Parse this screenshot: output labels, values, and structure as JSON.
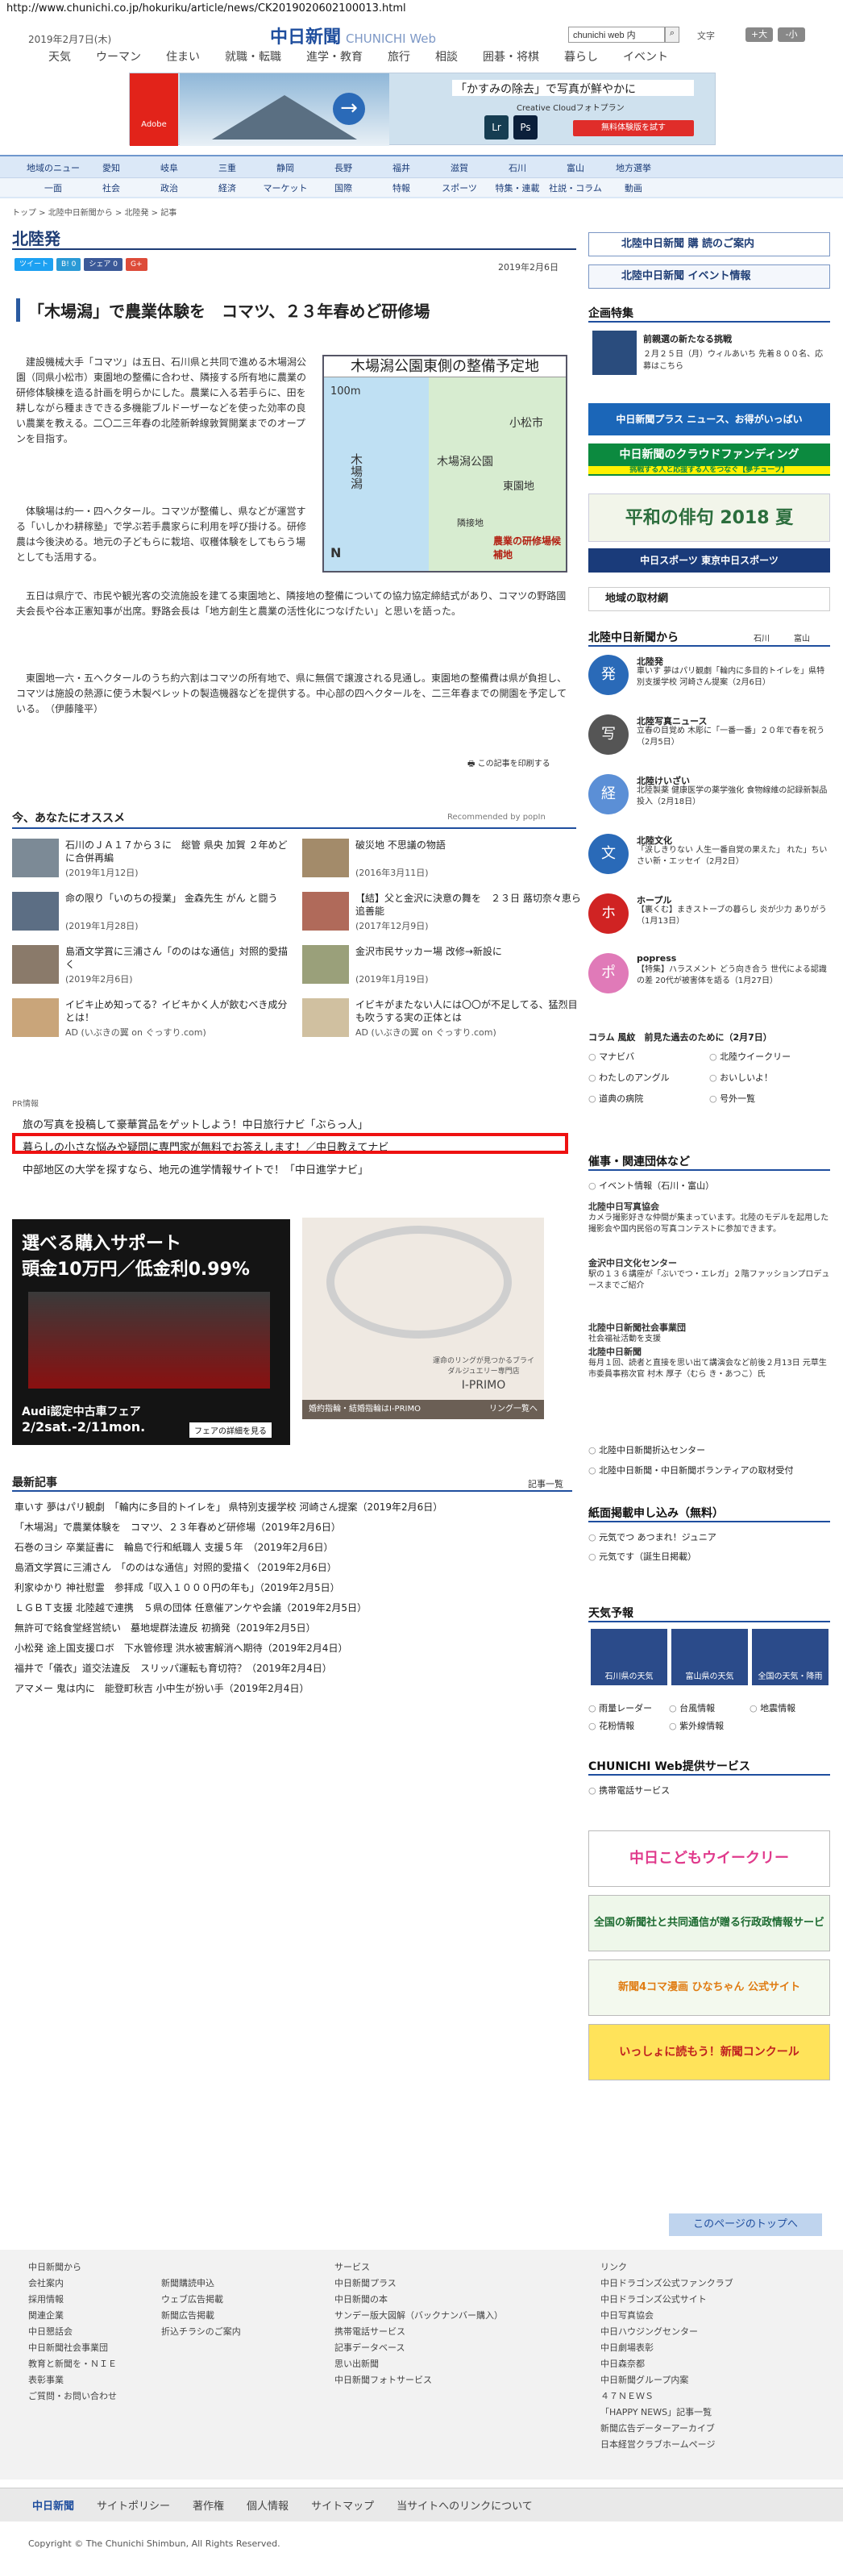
{
  "url": "http://www.chunichi.co.jp/hokuriku/article/news/CK2019020602100013.html",
  "date": "2019年2月7日(木)",
  "logo": {
    "jp": "中日新聞",
    "en": "CHUNICHI Web"
  },
  "search": {
    "value": "chunichi web 内"
  },
  "fontsize": {
    "label": "文字",
    "large": "+大",
    "small": "-小"
  },
  "topnav": [
    "天気",
    "ウーマン",
    "住まい",
    "就職・転職",
    "進学・教育",
    "旅行",
    "相談",
    "囲碁・将棋",
    "暮らし",
    "イベント"
  ],
  "ad_top": {
    "text": "「かすみの除去」で写真が鮮やかに",
    "sub": "Creative Cloudフォトプラン",
    "cta": "無料体験版を試す",
    "lr": "Lr",
    "ps": "Ps",
    "adobe": "Adobe"
  },
  "navrow1": [
    "地域のニュース",
    "愛知",
    "岐阜",
    "三重",
    "静岡",
    "長野",
    "福井",
    "滋賀",
    "石川",
    "富山",
    "地方選挙"
  ],
  "navrow2": [
    "一面",
    "社会",
    "政治",
    "経済",
    "マーケット",
    "国際",
    "特報",
    "スポーツ",
    "特集・連載",
    "社説・コラム",
    "動画"
  ],
  "breadcrumb": "トップ > 北陸中日新聞から > 北陸発 > 記事",
  "section_title": "北陸発",
  "share": {
    "tweet": "ツイート",
    "b": "B! 0",
    "share": "シェア 0",
    "g": "G+"
  },
  "pubdate": "2019年2月6日",
  "headline": "「木場潟」で農業体験を　コマツ、２３年春めど研修場",
  "paragraphs": [
    "　建設機械大手「コマツ」は五日、石川県と共同で進める木場潟公園（同県小松市）東園地の整備に合わせ、隣接する所有地に農業の研修体験棟を造る計画を明らかにした。農業に入る若手らに、田を耕しながら種まきできる多機能ブルドーザーなどを使った効率の良い農業を教える。二〇二三年春の北陸新幹線敦賀開業までのオープンを目指す。",
    "　体験場は約一・四ヘクタール。コマツが整備し、県などが運営する「いしかわ耕稼塾」で学ぶ若手農家らに利用を呼び掛ける。研修農は今後決める。地元の子どもらに栽培、収穫体験をしてもらう場としても活用する。",
    "　五日は県庁で、市民や観光客の交流施設を建てる東園地と、隣接地の整備についての協力協定締結式があり、コマツの野路國夫会長や谷本正憲知事が出席。野路会長は「地方創生と農業の活性化につなげたい」と思いを語った。",
    "　東園地一六・五ヘクタールのうち約六割はコマツの所有地で、県に無償で譲渡される見通し。東園地の整備費は県が負担し、コマツは施設の熱源に使う木製ペレットの製造機器などを提供する。中心部の四ヘクタールを、二三年春までの開園を予定している。　（伊藤隆平）"
  ],
  "map": {
    "title": "木場潟公園東側の整備予定地",
    "scale": "100m",
    "lake": "木場潟",
    "park": "木場潟公園",
    "east": "東園地",
    "city": "小松市",
    "plan": "農業の研修場候補地",
    "n": "N",
    "kenchi": "隣接地"
  },
  "print": "この記事を印刷する",
  "recommend": {
    "title": "今、あなたにオススメ",
    "by": "Recommended by popIn"
  },
  "recos": [
    {
      "t": "石川のＪＡ１７から３に　総管 県央 加賀 ２年めどに合併再編",
      "d": "(2019年1月12日)"
    },
    {
      "t": "破災地 不思議の物語",
      "d": "(2016年3月11日)"
    },
    {
      "t": "命の限り「いのちの授業」 金森先生 がん と闘う",
      "d": "(2019年1月28日)"
    },
    {
      "t": "【結】父と金沢に決意の舞を　２３日 蕗切奈々恵ら追善能",
      "d": "(2017年12月9日)"
    },
    {
      "t": "島酒文学賞に三浦さん「ののはな通信」対照的愛描く",
      "d": "(2019年2月6日)"
    },
    {
      "t": "金沢市民サッカー場 改修→新設に",
      "d": "(2019年1月19日)"
    },
    {
      "t": "イビキ止め知ってる？イビキかく人が飲むべき成分とは！",
      "d": "AD (いぶきの翼 on ぐっすり.com)"
    },
    {
      "t": "イビキがまたない人には〇〇が不足してる、猛烈目も吹うする実の正体とは",
      "d": "AD (いぶきの翼 on ぐっすり.com)"
    }
  ],
  "pr": {
    "label": "PR情報",
    "links": [
      "旅の写真を投稿して豪華賞品をゲットしよう！中日旅行ナビ「ぶらっ人」",
      "暮らしの小さな悩みや疑問に専門家が無料でお答えします！／中日教えてナビ",
      "中部地区の大学を探すなら、地元の進学情報サイトで！「中日進学ナビ」"
    ]
  },
  "ad_audi": {
    "l1": "選べる購入サポート",
    "l2": "頭金10万円／低金利0.99%",
    "l3": "Audi認定中古車フェア",
    "l4": "2/2sat.-2/11mon.",
    "cta": "フェアの詳細を見る"
  },
  "ad_ring": {
    "t": "運命のリングが見つかるブライダルジュエリー専門店",
    "brand": "I-PRIMO",
    "cta1": "婚約指輪・結婚指輪はI-PRIMO",
    "cta2": "リング一覧へ"
  },
  "latest": {
    "title": "最新記事",
    "more": "記事一覧",
    "items": [
      "車いす 夢はパリ観劇　「輪内に多目的トイレを」 県特別支援学校 河崎さん提案（2019年2月6日）",
      "「木場潟」で農業体験を　コマツ、２３年春めど研修場（2019年2月6日）",
      "石巻のヨシ 卒業証書に　輪島で行和紙職人 支援５年　（2019年2月6日）",
      "島酒文学賞に三浦さん　「ののはな通信」対照的愛描く（2019年2月6日）",
      "利家ゆかり 神社慰霊　参拝成「収入１０００円の年も」（2019年2月5日）",
      "ＬＧＢＴ支援 北陸越で連携　５県の団体 任意催アンケや会議（2019年2月5日）",
      "無許可で銘食堂経営続い　墓地堤群法違反 初摘発（2019年2月5日）",
      "小松発 途上国支援ロボ　下水管修理 洪水被害解消へ期待（2019年2月4日）",
      "福井で「儀衣」道交法違反　スリッパ運転も育切符？（2019年2月4日）",
      "アマメー 鬼は内に　能登町秋吉 小中生が扮い手（2019年2月4日）"
    ]
  },
  "right": {
    "subscribe": "北陸中日新聞 購 読のご案内",
    "event": "北陸中日新聞 イベント情報",
    "feature_title": "企画特集",
    "feature": {
      "t": "前親選の新たなる挑戦",
      "x": "２月２５日（月）ウィルあいち 先着８００名、応募はこちら"
    },
    "b1": "中日新聞プラス ニュース、お得がいっぱい",
    "b2": "中日新聞のクラウドファンディング",
    "b2s": "挑戦する人と応援する人をつなぐ【夢チューブ】",
    "b3": "平和の俳句 2018 夏",
    "b4": "中日スポーツ 東京中日スポーツ",
    "region_link": "地域の取材網",
    "from_title": "北陸中日新聞から",
    "from_links": [
      "石川",
      "富山"
    ],
    "items": [
      {
        "c": "#2a6ab8",
        "i": "発",
        "t": "北陸発",
        "x": "車いす 夢はパリ観劇「輪内に多目的トイレを」県特別支援学校 河崎さん提案（2月6日）"
      },
      {
        "c": "#555",
        "i": "写",
        "t": "北陸写真ニュース",
        "x": "立春の目覚め 木彫に「一番一番」２０年で春を祝う（2月5日）"
      },
      {
        "c": "#5b8fd6",
        "i": "経",
        "t": "北陸けいざい",
        "x": "北陸製薬 健康医学の薬学強化 食物線維の記録新製品投入（2月18日）"
      },
      {
        "c": "#2a6ab8",
        "i": "文",
        "t": "北陸文化",
        "x": "「涙しきりない 人生一番自覚の果えた」 れた」ちいさい新・エッセイ（2月2日）"
      },
      {
        "c": "#d02323",
        "i": "ホ",
        "t": "ホープル",
        "x": "【裏くむ】まきストーブの暮らし 炎が少力 ありがう（1月13日）"
      },
      {
        "c": "#e07ab8",
        "i": "ポ",
        "t": "popress",
        "x": "【特集】ハラスメント どう向き合う 世代による認識の差 20代が被害体を語る（1月27日）"
      }
    ],
    "column_link": "コラム 風紋　前見た過去のために（2月7日）",
    "links2": [
      "マナビバ",
      "北陸ウイークリー",
      "わたしのアングル",
      "おいしいよ！",
      "道典の病院",
      "号外一覧"
    ],
    "org_title": "催事・関連団体など",
    "evt_link": "イベント情報（石川・富山）",
    "events": [
      {
        "t": "北陸中日写真協会",
        "x": "カメラ撮影好きな仲間が集まっています。北陸のモデルを起用した撮影会や国内民俗の写真コンテストに参加できます。"
      },
      {
        "t": "金沢中日文化センター",
        "x": "駅の１３６講座が「ぶいでつ・エレガ」２階ファッションプロデュースまでご紹介"
      },
      {
        "t": "北陸中日新聞社会事業団",
        "x": "社会福祉活動を支援"
      },
      {
        "t": "北陸中日新聞",
        "x": "毎月１回、読者と直接を思い出て講演会など前後２月13日 元草生市委員事務次官 村木 厚子（むら き・あつこ）氏"
      }
    ],
    "flinks": [
      "北陸中日新聞折込センター",
      "北陸中日新聞・中日新聞ボランティアの取材受付"
    ],
    "paper_title": "紙面掲載申し込み（無料）",
    "paper_links": [
      "元気でつ あつまれ！ジュニア",
      "元気です（誕生日掲載）"
    ],
    "weather_title": "天気予報",
    "weather": [
      "石川県の天気",
      "富山県の天気",
      "全国の天気・降雨"
    ],
    "wlinks": [
      "雨量レーダー",
      "台風情報",
      "地震情報",
      "花粉情報",
      "紫外線情報"
    ],
    "svc_title": "CHUNICHI Web提供サービス",
    "svc_link": "携帯電話サービス",
    "ads": [
      "中日こどもウイークリー",
      "全国の新聞社と共同通信が贈る行政政情報サービス 47行政ジャーナル",
      "新聞4コマ漫画 ひなちゃん 公式サイト",
      "いっしょに読もう！新聞コンクール"
    ]
  },
  "totop": "このページのトップへ",
  "footer": {
    "c1": [
      "中日新聞から",
      "会社案内",
      "採用情報",
      "関連企業",
      "中日懇話会",
      "中日新聞社会事業団",
      "教育と新聞を・ＮＩＥ",
      "表彰事業",
      "ご質問・お問い合わせ"
    ],
    "c2": [
      "新聞購読申込",
      "ウェブ広告掲載",
      "新聞広告掲載",
      "折込チラシのご案内"
    ],
    "c3h": "サービス",
    "c3": [
      "中日新聞プラス",
      "中日新聞の本",
      "サンデー版大図解（バックナンバー購入）",
      "携帯電話サービス",
      "記事データベース",
      "思い出新聞",
      "中日新聞フォトサービス"
    ],
    "c4h": "リンク",
    "c4": [
      "中日ドラゴンズ公式ファンクラブ",
      "中日ドラゴンズ公式サイト",
      "中日写真協会",
      "中日ハウジングセンター",
      "中日劇場表彰",
      "中日森奈都",
      "中日新聞グループ内案",
      "４７ＮＥＷＳ",
      "「HAPPY NEWS」記事一覧",
      "新聞広告データーアーカイブ",
      "日本経営クラブホームページ"
    ]
  },
  "footlinks": [
    "中日新聞",
    "サイトポリシー",
    "著作権",
    "個人情報",
    "サイトマップ",
    "当サイトへのリンクについて"
  ],
  "copyright": "Copyright © The Chunichi Shimbun, All Rights Reserved."
}
